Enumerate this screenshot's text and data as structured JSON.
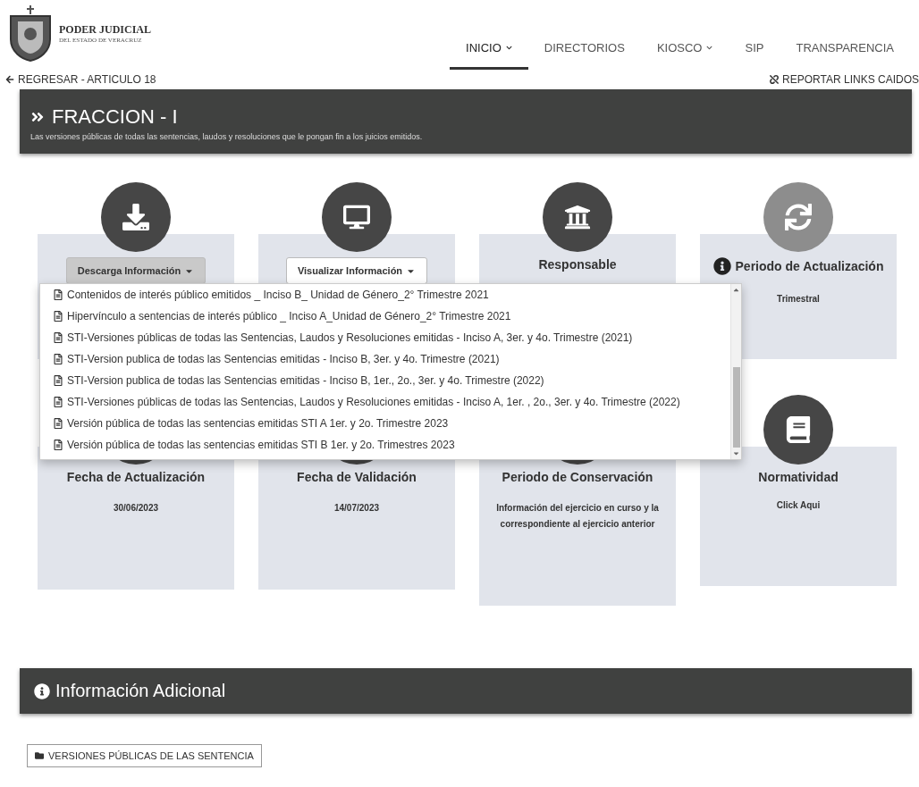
{
  "header": {
    "logo_title": "PODER JUDICIAL",
    "logo_subtitle": "DEL ESTADO DE VERACRUZ",
    "nav": [
      {
        "label": "INICIO",
        "selected": true,
        "has_menu": true
      },
      {
        "label": "DIRECTORIOS",
        "selected": false,
        "has_menu": false
      },
      {
        "label": "KIOSCO",
        "selected": false,
        "has_menu": true
      },
      {
        "label": "SIP",
        "selected": false,
        "has_menu": false
      },
      {
        "label": "TRANSPARENCIA",
        "selected": false,
        "has_menu": false
      }
    ]
  },
  "back_link": "REGRESAR - ARTICULO 18",
  "report_link": "REPORTAR LINKS CAIDOS",
  "banner": {
    "title": "FRACCION - I",
    "description": "Las versiones públicas de todas las sentencias, laudos y resoluciones que le pongan fin a los juicios emitidos."
  },
  "cards": [
    {
      "kind": "dropdown",
      "label": "Descarga Información",
      "open": true,
      "menu_items": [
        "Contenidos de interés público emitidos _ Inciso B_ Unidad de Género_2° Trimestre 2021",
        "Hipervínculo a sentencias de interés público _ Inciso A_Unidad de Género_2° Trimestre 2021",
        "STI-Versiones públicas de todas las Sentencias, Laudos y Resoluciones emitidas - Inciso A, 3er. y 4o. Trimestre (2021)",
        "STI-Version publica de todas las Sentencias emitidas - Inciso B, 3er. y 4o. Trimestre (2021)",
        "STI-Version publica de todas las Sentencias emitidas - Inciso B, 1er., 2o., 3er. y 4o. Trimestre (2022)",
        "STI-Versiones públicas de todas las Sentencias, Laudos y Resoluciones emitidas - Inciso A, 1er. , 2o., 3er. y 4o. Trimestre (2022)",
        "Versión pública de todas las sentencias emitidas STI A 1er. y 2o. Trimestre 2023",
        "Versión pública de todas las sentencias emitidas STI B 1er. y 2o. Trimestres 2023"
      ]
    },
    {
      "kind": "dropdown",
      "label": "Visualizar Información",
      "open": false
    },
    {
      "kind": "text",
      "title": "Responsable"
    },
    {
      "kind": "text",
      "title": "Periodo de Actualización",
      "info": true,
      "value": "Trimestral"
    },
    {
      "kind": "text",
      "title": "Fecha de Actualización",
      "value": "30/06/2023"
    },
    {
      "kind": "text",
      "title": "Fecha de Validación",
      "value": "14/07/2023"
    },
    {
      "kind": "text",
      "title": "Periodo de Conservación",
      "value": "Información del ejercicio en curso y la correspondiente al ejercicio anterior"
    },
    {
      "kind": "link",
      "title": "Normatividad",
      "value": "Click Aqui"
    }
  ],
  "additional": {
    "title": "Información Adicional",
    "buttons": [
      "VERSIONES PÚBLICAS DE LAS SENTENCIA"
    ]
  }
}
